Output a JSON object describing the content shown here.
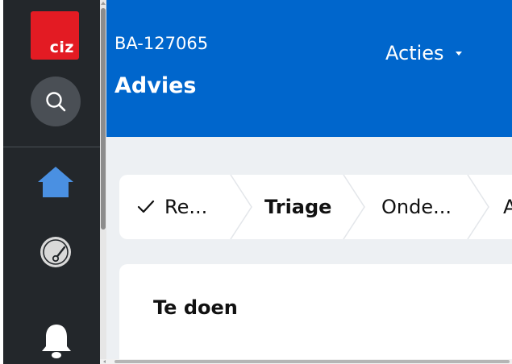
{
  "sidebar": {
    "logo_text": "ciz",
    "colors": {
      "background": "#23272b",
      "logo": "#e31b23",
      "home_icon": "#4a90e2"
    },
    "icons": [
      "search-icon",
      "home-icon",
      "dashboard-gauge-icon",
      "bell-icon"
    ]
  },
  "header": {
    "case_id": "BA-127065",
    "title": "Advies",
    "actions_label": "Acties",
    "background": "#0066cc"
  },
  "stepper": {
    "steps": [
      {
        "label": "Re...",
        "state": "completed"
      },
      {
        "label": "Triage",
        "state": "current"
      },
      {
        "label": "Onde...",
        "state": "upcoming"
      },
      {
        "label": "A",
        "state": "upcoming"
      }
    ]
  },
  "main": {
    "card_title": "Te doen"
  }
}
